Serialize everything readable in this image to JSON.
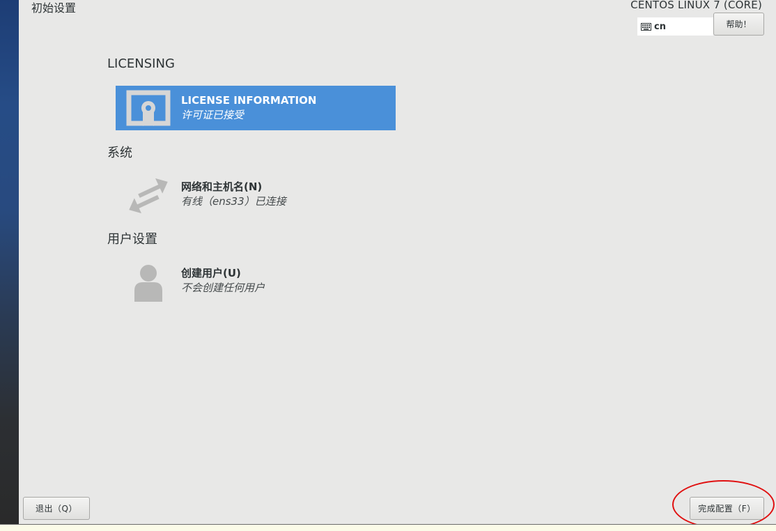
{
  "header": {
    "page_title": "初始设置",
    "product_title": "CENTOS LINUX 7 (CORE)",
    "keyboard_layout": "cn",
    "help_label": "帮助！"
  },
  "sections": {
    "licensing": {
      "heading": "LICENSING",
      "spoke": {
        "title": "LICENSE INFORMATION",
        "status": "许可证已接受",
        "icon": "license-icon"
      }
    },
    "system": {
      "heading": "系统",
      "spoke": {
        "title": "网络和主机名(N)",
        "status": "有线（ens33）已连接",
        "icon": "network-arrows-icon"
      }
    },
    "user_settings": {
      "heading": "用户设置",
      "spoke": {
        "title": "创建用户(U)",
        "status": "不会创建任何用户",
        "icon": "user-icon"
      }
    }
  },
  "footer": {
    "quit_label": "退出（Q）",
    "finish_label": "完成配置（F）"
  },
  "colors": {
    "selected_spoke": "#4a90d9",
    "annotation_circle": "#e01010",
    "background": "#e8e8e7"
  }
}
